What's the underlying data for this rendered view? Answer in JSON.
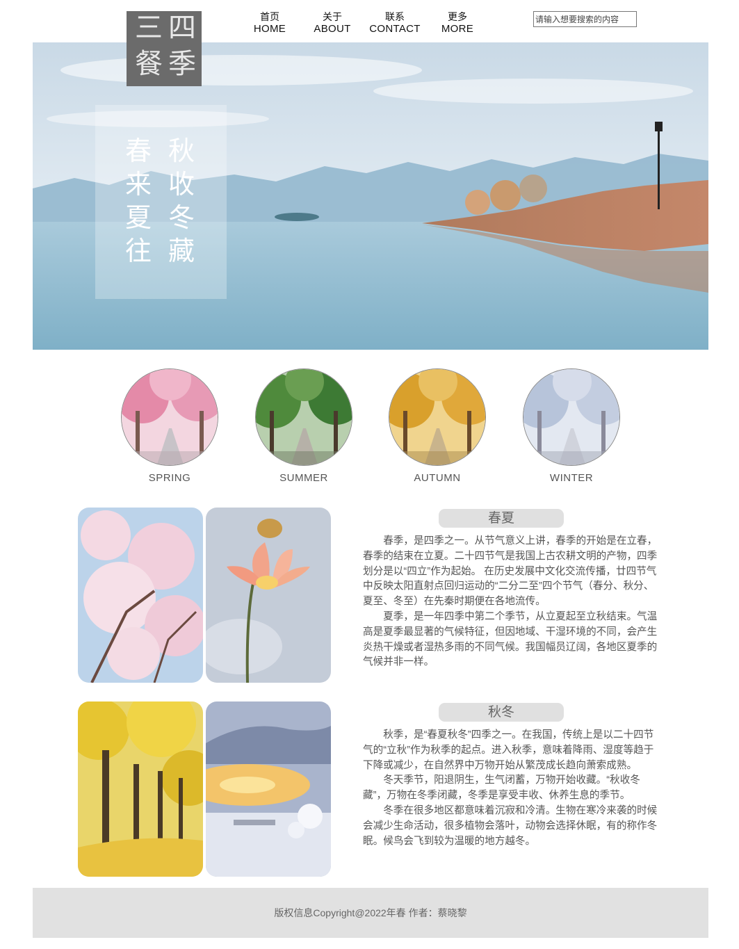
{
  "logo": {
    "chars": [
      "三",
      "四",
      "餐",
      "季"
    ]
  },
  "nav": [
    {
      "zh": "首页",
      "en": "HOME"
    },
    {
      "zh": "关于",
      "en": "ABOUT"
    },
    {
      "zh": "联系",
      "en": "CONTACT"
    },
    {
      "zh": "更多",
      "en": "MORE"
    }
  ],
  "search": {
    "placeholder": "请输入想要搜索的内容"
  },
  "banner": {
    "slogan_left": [
      "春",
      "来",
      "夏",
      "往"
    ],
    "slogan_right": [
      "秋",
      "收",
      "冬",
      "藏"
    ]
  },
  "seasons": [
    {
      "label": "SPRING",
      "color": "#e48aa8"
    },
    {
      "label": "SUMMER",
      "color": "#4f8a3c"
    },
    {
      "label": "AUTUMN",
      "color": "#d9a02c"
    },
    {
      "label": "WINTER",
      "color": "#b7c4da"
    }
  ],
  "sections": [
    {
      "title": "春夏",
      "paragraphs": [
        "春季，是四季之一。从节气意义上讲，春季的开始是在立春，春季的结束在立夏。二十四节气是我国上古农耕文明的产物，四季划分是以“四立”作为起始。 在历史发展中文化交流传播，廿四节气中反映太阳直射点回归运动的“二分二至”四个节气（春分、秋分、夏至、冬至）在先秦时期便在各地流传。",
        "夏季，是一年四季中第二个季节，从立夏起至立秋结束。气温高是夏季最显著的气候特征，但因地域、干湿环境的不同，会产生炎热干燥或者湿热多雨的不同气候。我国幅员辽阔，各地区夏季的气候并非一样。"
      ]
    },
    {
      "title": "秋冬",
      "paragraphs": [
        "秋季，是“春夏秋冬”四季之一。在我国，传统上是以二十四节气的“立秋”作为秋季的起点。进入秋季，意味着降雨、湿度等趋于下降或减少，在自然界中万物开始从繁茂成长趋向萧索成熟。",
        "冬天季节，阳退阴生，生气闭蓄，万物开始收藏。“秋收冬藏”，万物在冬季闭藏，冬季是享受丰收、休养生息的季节。",
        "冬季在很多地区都意味着沉寂和冷清。生物在寒冷来袭的时候会减少生命活动，很多植物会落叶，动物会选择休眠，有的称作冬眠。候鸟会飞到较为温暖的地方越冬。"
      ]
    }
  ],
  "footer": {
    "text": "版权信息Copyright@2022年春  作者：蔡晓黎"
  }
}
